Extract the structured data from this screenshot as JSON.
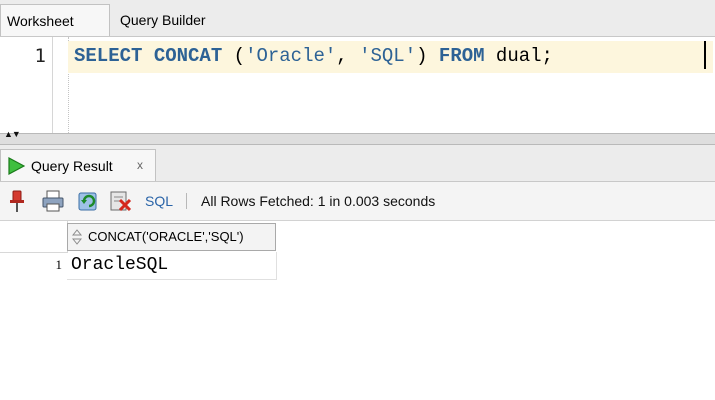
{
  "editor": {
    "tabs": [
      {
        "label": "Worksheet",
        "active": true
      },
      {
        "label": "Query Builder",
        "active": false
      }
    ],
    "line_number": "1",
    "sql": {
      "select": "SELECT",
      "concat": "CONCAT",
      "open": " (",
      "arg1": "'Oracle'",
      "comma": ", ",
      "arg2": "'SQL'",
      "close": ") ",
      "from": "FROM",
      "table": " dual;"
    }
  },
  "results": {
    "tab": {
      "label": "Query Result",
      "close_glyph": "x"
    },
    "toolbar": {
      "buttons": [
        "pin-icon",
        "print-icon",
        "refresh-icon",
        "export-icon"
      ],
      "sql_label": "SQL",
      "status": "All Rows Fetched: 1 in 0.003 seconds"
    },
    "columns": [
      "CONCAT('ORACLE','SQL')"
    ],
    "rows": [
      {
        "num": "1",
        "values": [
          "OracleSQL"
        ]
      }
    ]
  },
  "colors": {
    "keyword": "#2d6295",
    "current_line": "#fdf6dd",
    "link": "#2a64a8"
  }
}
